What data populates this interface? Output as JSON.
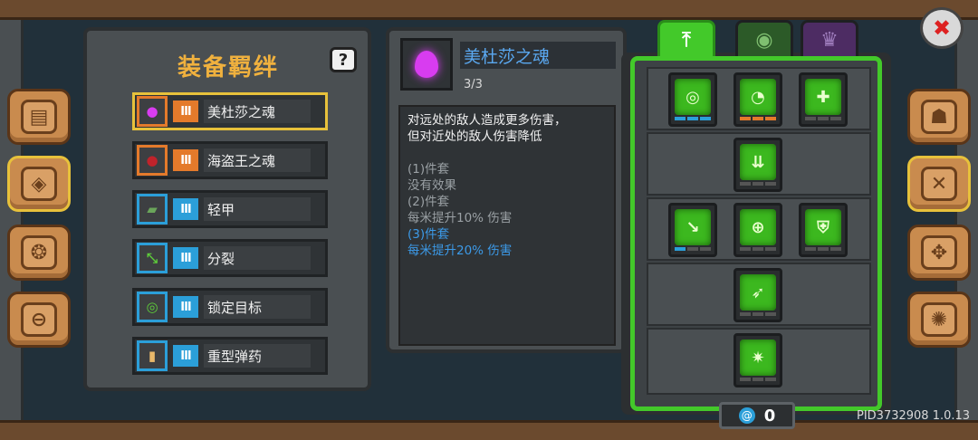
{
  "bonds_panel": {
    "title": "装备羁绊",
    "help_label": "?",
    "items": [
      {
        "label": "美杜莎之魂",
        "bars": "III",
        "color": "orange",
        "icon": "soul-flame-icon",
        "selected": true
      },
      {
        "label": "海盗王之魂",
        "bars": "III",
        "color": "orange",
        "icon": "pirate-soul-icon",
        "selected": false
      },
      {
        "label": "轻甲",
        "bars": "III",
        "color": "blue",
        "icon": "light-armor-icon",
        "selected": false
      },
      {
        "label": "分裂",
        "bars": "III",
        "color": "blue",
        "icon": "split-arrows-icon",
        "selected": false
      },
      {
        "label": "锁定目标",
        "bars": "III",
        "color": "blue",
        "icon": "crosshair-icon",
        "selected": false
      },
      {
        "label": "重型弹药",
        "bars": "III",
        "color": "blue",
        "icon": "heavy-ammo-icon",
        "selected": false
      }
    ]
  },
  "detail_panel": {
    "name": "美杜莎之魂",
    "count": "3/3",
    "desc": [
      "对远处的敌人造成更多伤害，",
      "但对近处的敌人伤害降低"
    ],
    "tiers": [
      {
        "label": "(1)件套",
        "effect": "没有效果",
        "active": false
      },
      {
        "label": "(2)件套",
        "effect": "每米提升10% 伤害",
        "active": false
      },
      {
        "label": "(3)件套",
        "effect": "每米提升20% 伤害",
        "active": true
      }
    ]
  },
  "tree_tabs": [
    {
      "icon": "bow-icon",
      "glyph": "⤒",
      "active": true
    },
    {
      "icon": "eye-icon",
      "glyph": "◉",
      "active": false
    },
    {
      "icon": "crown-icon",
      "glyph": "♛",
      "active": false
    }
  ],
  "skills": [
    {
      "icon": "ring-target-icon",
      "glyph": "◎",
      "pips": "blue"
    },
    {
      "icon": "radar-sweep-icon",
      "glyph": "◔",
      "pips": "orange"
    },
    {
      "icon": "plus-heal-icon",
      "glyph": "✚",
      "pips": "none"
    },
    {
      "icon": "ground-burst-icon",
      "glyph": "⇊",
      "pips": "none"
    },
    {
      "icon": "vortex-arrow-icon",
      "glyph": "↘",
      "pips": "blue"
    },
    {
      "icon": "turret-aim-icon",
      "glyph": "⊕",
      "pips": "none"
    },
    {
      "icon": "shield-icon",
      "glyph": "⛨",
      "pips": "none"
    },
    {
      "icon": "piercing-shot-icon",
      "glyph": "➶",
      "pips": "none"
    },
    {
      "icon": "gear-star-icon",
      "glyph": "✷",
      "pips": "none"
    }
  ],
  "currency": {
    "icon": "gem-icon",
    "count": "0"
  },
  "version_text": "PID3732908 1.0.13",
  "side_tabs_left": [
    "book-icon",
    "map-scroll-icon",
    "cog-cluster-icon",
    "steering-icon"
  ],
  "side_tabs_right": [
    "helmet-icon",
    "swords-icon",
    "compass-icon",
    "gear-icon"
  ],
  "colors": {
    "accent_green": "#43c92a",
    "highlight_gold": "#e7c13b",
    "bond_orange": "#e47a2b",
    "bond_blue": "#2b9fd9",
    "title_gold": "#f0b13e"
  }
}
